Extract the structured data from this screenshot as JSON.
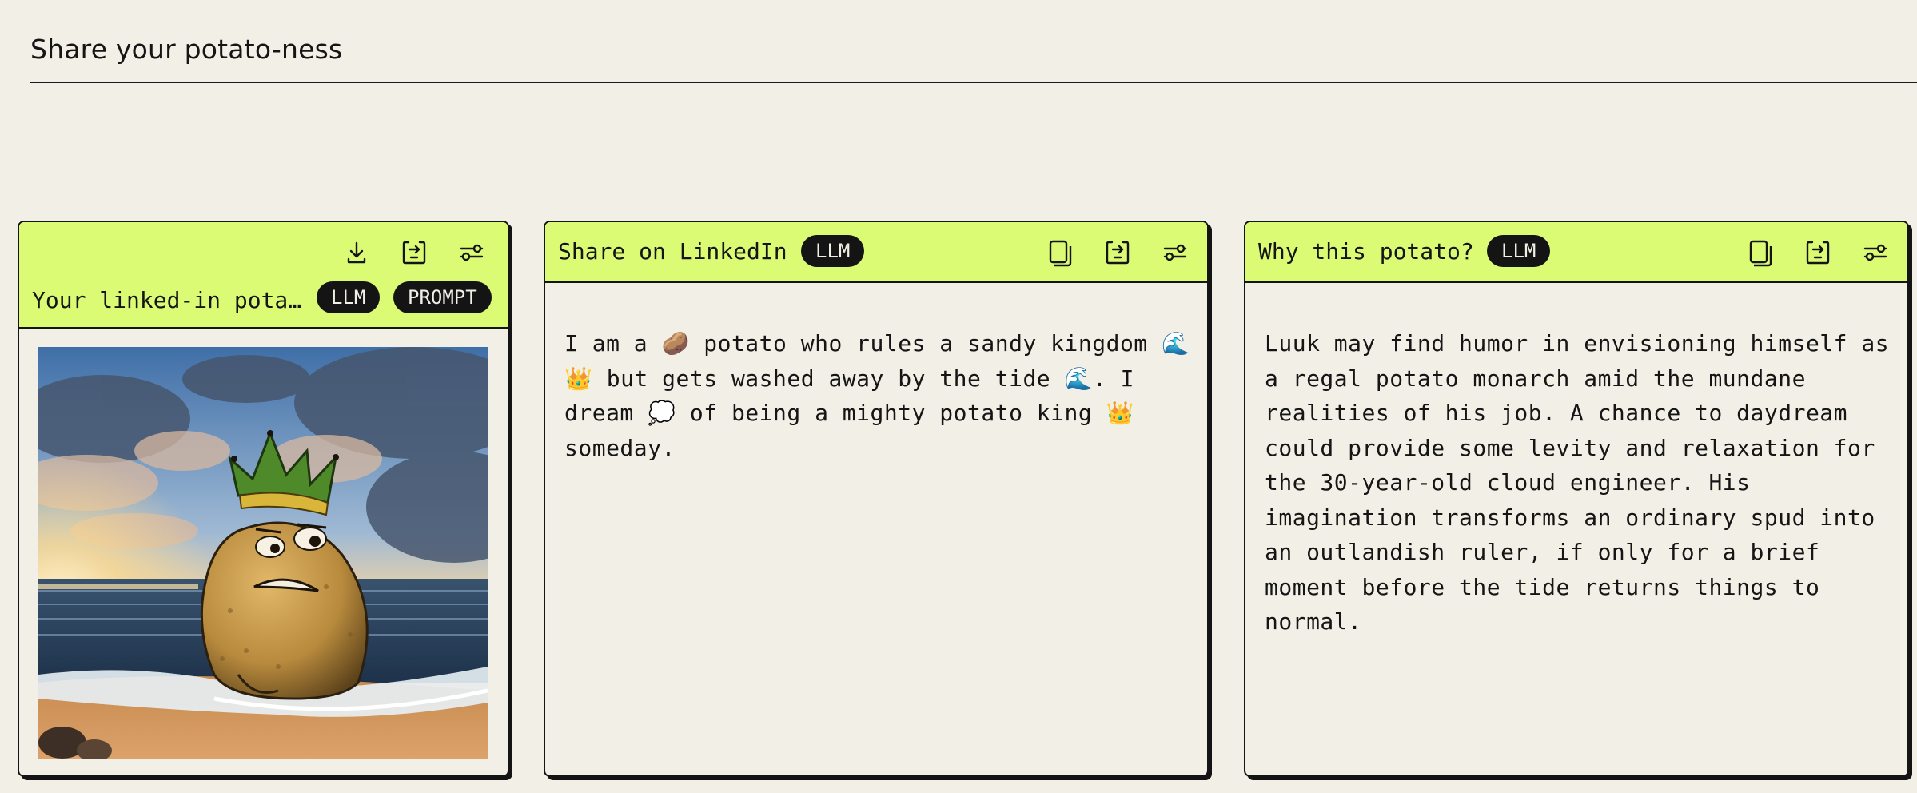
{
  "page": {
    "title": "Share your potato-ness"
  },
  "cards": {
    "image": {
      "title": "Your linked-in pota…",
      "tags": [
        "LLM",
        "PROMPT"
      ],
      "actions": [
        "download-icon",
        "share-icon",
        "settings-sliders-icon"
      ]
    },
    "linkedin": {
      "title": "Share on LinkedIn",
      "tag": "LLM",
      "actions": [
        "copy-icon",
        "share-icon",
        "settings-sliders-icon"
      ],
      "text": "I am a 🥔 potato who rules a sandy kingdom 🌊👑 but gets washed away by the tide 🌊. I dream 💭 of being a mighty potato king 👑 someday."
    },
    "why": {
      "title": "Why this potato?",
      "tag": "LLM",
      "actions": [
        "copy-icon",
        "share-icon",
        "settings-sliders-icon"
      ],
      "text": "Luuk may find humor in envisioning himself as a regal potato monarch amid the mundane realities of his job. A chance to daydream could provide some levity and relaxation for the 30-year-old cloud engineer. His imagination transforms an ordinary spud into an outlandish ruler, if only for a brief moment before the tide returns things to normal."
    }
  },
  "colors": {
    "background": "#f2f0e6",
    "header_accent": "#dcfb74",
    "ink": "#141414"
  }
}
